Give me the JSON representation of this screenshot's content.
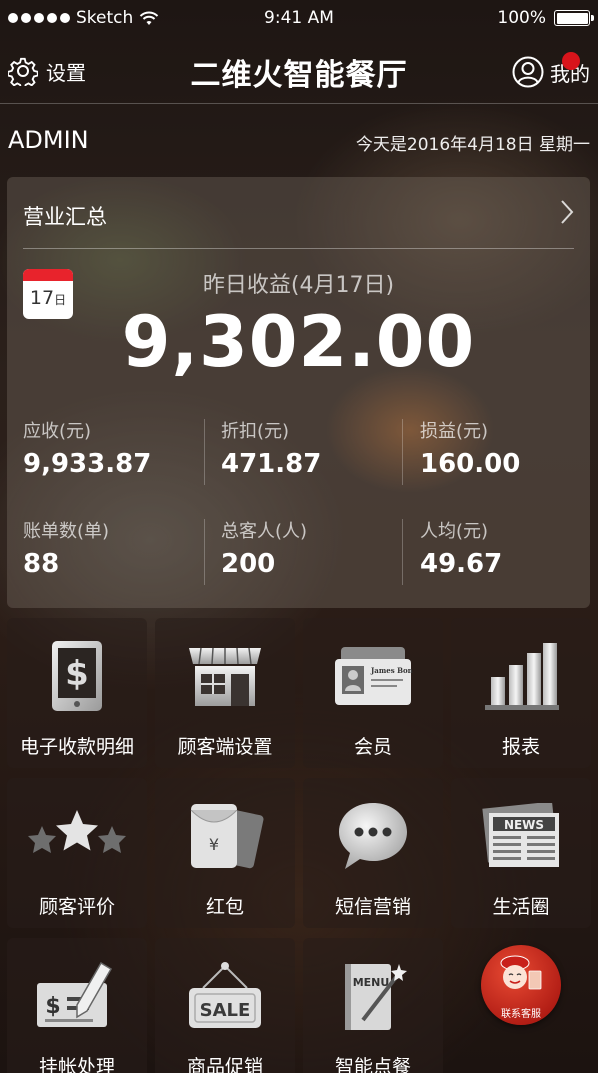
{
  "status_bar": {
    "carrier": "Sketch",
    "time": "9:41 AM",
    "battery": "100%"
  },
  "nav": {
    "settings_label": "设置",
    "title": "二维火智能餐厅",
    "profile_label": "我的"
  },
  "info": {
    "username": "ADMIN",
    "today": "今天是2016年4月18日 星期一"
  },
  "summary": {
    "title": "营业汇总",
    "calendar_day": "17",
    "calendar_suffix": "日",
    "yesterday_label": "昨日收益(4月17日)",
    "yesterday_value": "9,302.00",
    "stats": [
      {
        "label": "应收(元)",
        "value": "9,933.87"
      },
      {
        "label": "折扣(元)",
        "value": "471.87"
      },
      {
        "label": "损益(元)",
        "value": "160.00"
      },
      {
        "label": "账单数(单)",
        "value": "88"
      },
      {
        "label": "总客人(人)",
        "value": "200"
      },
      {
        "label": "人均(元)",
        "value": "49.67"
      }
    ]
  },
  "grid": [
    {
      "label": "电子收款明细",
      "icon": "tablet-dollar-icon"
    },
    {
      "label": "顾客端设置",
      "icon": "storefront-icon"
    },
    {
      "label": "会员",
      "icon": "member-card-icon"
    },
    {
      "label": "报表",
      "icon": "bar-chart-icon"
    },
    {
      "label": "顾客评价",
      "icon": "stars-icon"
    },
    {
      "label": "红包",
      "icon": "red-envelope-icon"
    },
    {
      "label": "短信营销",
      "icon": "chat-bubble-icon"
    },
    {
      "label": "生活圈",
      "icon": "newspaper-icon"
    },
    {
      "label": "挂帐处理",
      "icon": "cheque-pen-icon"
    },
    {
      "label": "商品促销",
      "icon": "sale-sign-icon"
    },
    {
      "label": "智能点餐",
      "icon": "menu-wand-icon"
    }
  ],
  "service": {
    "label": "联系客服"
  },
  "icon_text": {
    "card_name": "James Bond",
    "news": "NEWS",
    "sale": "SALE",
    "menu": "MENU"
  },
  "colors": {
    "accent_red": "#d8141b",
    "calendar_red": "#e8232c"
  }
}
